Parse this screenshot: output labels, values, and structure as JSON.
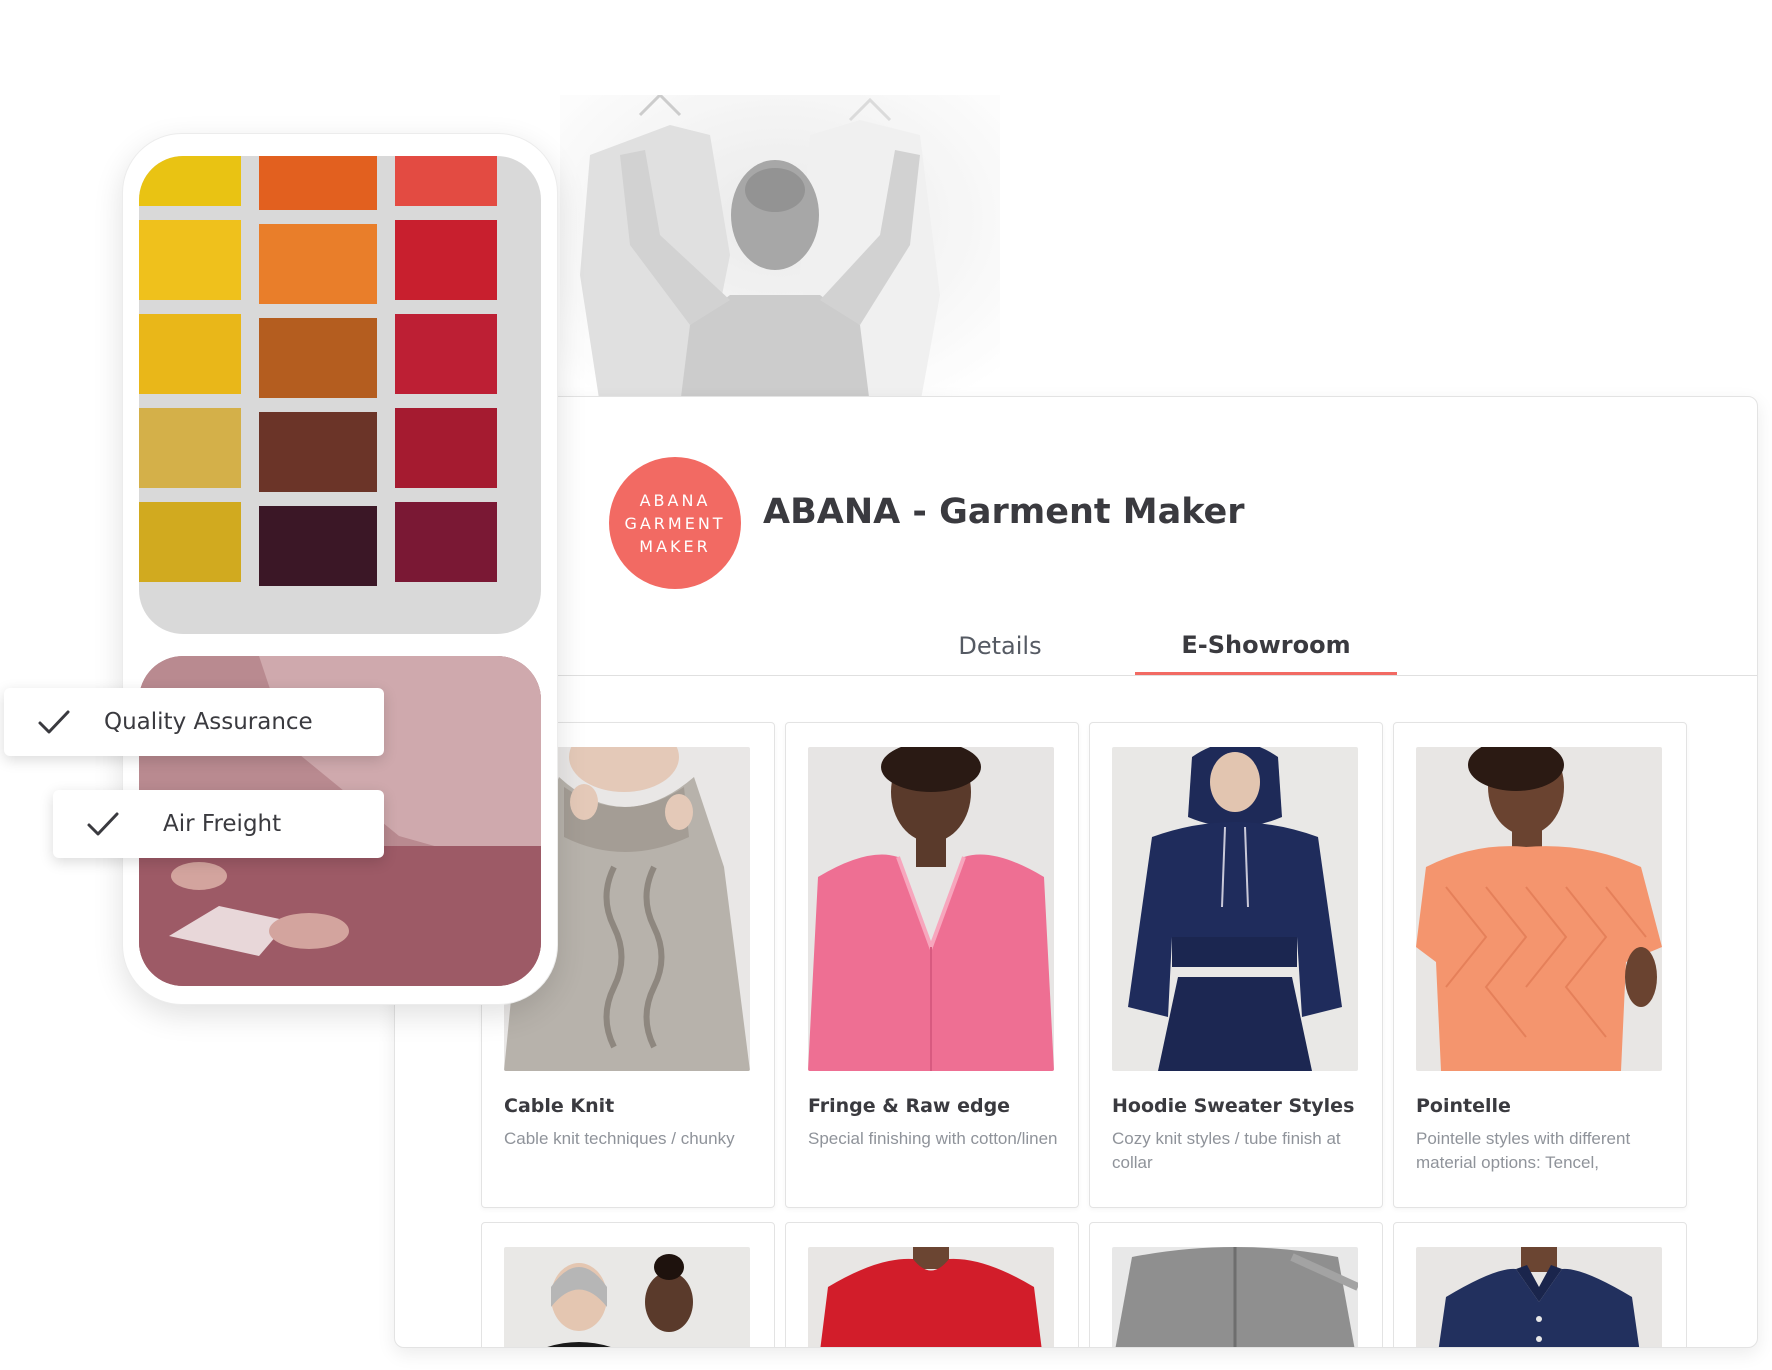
{
  "brand": {
    "logo_lines": [
      "ABANA",
      "GARMENT",
      "MAKER"
    ],
    "name": "ABANA - Garment Maker",
    "accent_color": "#f26a63"
  },
  "tabs": [
    {
      "label": "Details",
      "active": false
    },
    {
      "label": "E-Showroom",
      "active": true
    }
  ],
  "products": [
    {
      "title": "Cable Knit",
      "description": "Cable knit techniques / chunky"
    },
    {
      "title": "Fringe & Raw edge",
      "description": "Special finishing with cotton/linen"
    },
    {
      "title": "Hoodie Sweater Styles",
      "description": "Cozy knit styles / tube finish at collar"
    },
    {
      "title": "Pointelle",
      "description": "Pointelle styles with different material options: Tencel,"
    }
  ],
  "features": [
    {
      "label": "Quality Assurance",
      "icon": "check-icon"
    },
    {
      "label": "Air Freight",
      "icon": "check-icon"
    }
  ],
  "swatch_colors": [
    [
      "#e9c313",
      "#e2601f",
      "#e34b42"
    ],
    [
      "#efc11c",
      "#e97e2a",
      "#c81f2e"
    ],
    [
      "#e9b719",
      "#b45d1f",
      "#bd1f34"
    ],
    [
      "#d4b049",
      "#6b3428",
      "#a51b30"
    ],
    [
      "#d1aa1f",
      "#3b1726",
      "#7a1834"
    ]
  ]
}
